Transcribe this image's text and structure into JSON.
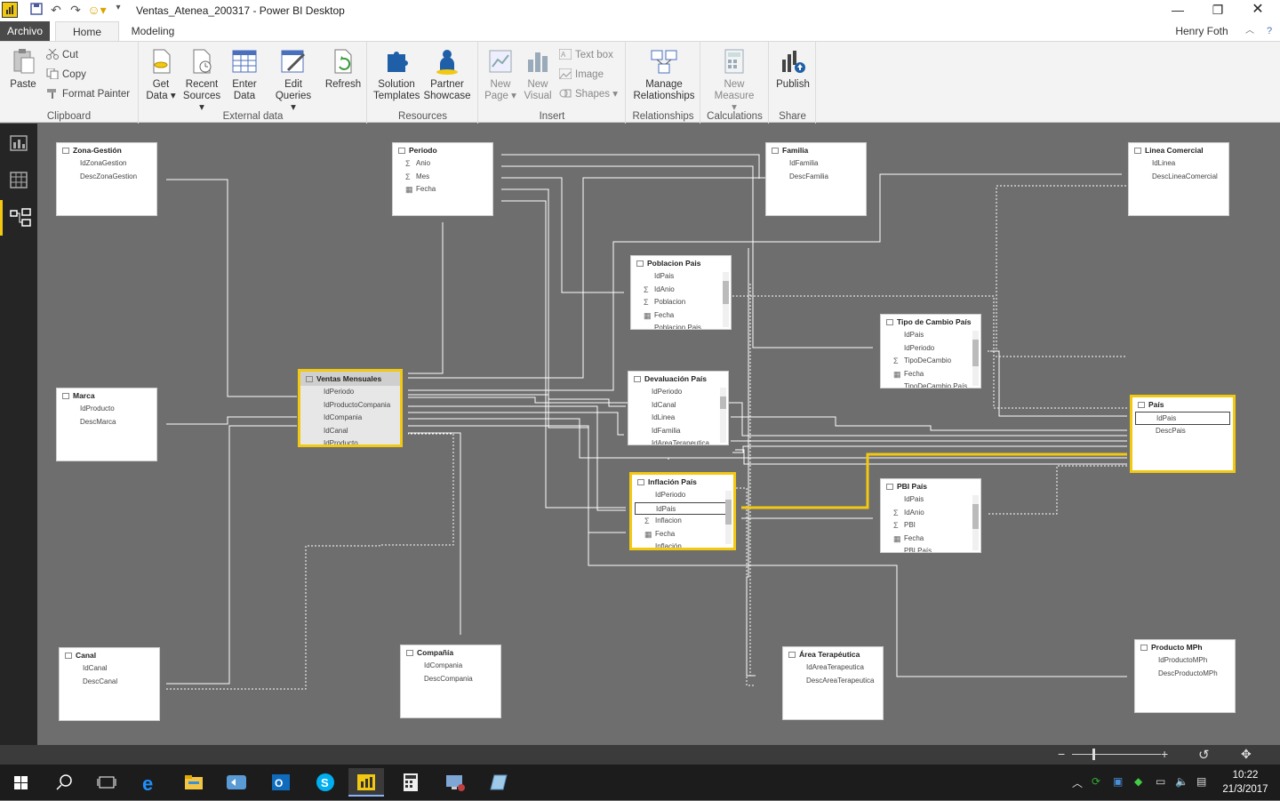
{
  "window": {
    "title": "Ventas_Atenea_200317 - Power BI Desktop",
    "user": "Henry Foth"
  },
  "tabs": [
    "Archivo",
    "Home",
    "Modeling"
  ],
  "ribbon": {
    "clipboard": {
      "label": "Clipboard",
      "paste": "Paste",
      "cut": "Cut",
      "copy": "Copy",
      "format_painter": "Format Painter"
    },
    "external": {
      "label": "External data",
      "get_data": "Get",
      "get_data2": "Data",
      "recent": "Recent",
      "recent2": "Sources",
      "enter": "Enter",
      "enter2": "Data",
      "edit": "Edit",
      "edit2": "Queries",
      "refresh": "Refresh"
    },
    "resources": {
      "label": "Resources",
      "solution": "Solution",
      "solution2": "Templates",
      "partner": "Partner",
      "partner2": "Showcase"
    },
    "insert": {
      "label": "Insert",
      "new_page": "New",
      "new_page2": "Page",
      "new_visual": "New",
      "new_visual2": "Visual",
      "text_box": "Text box",
      "image": "Image",
      "shapes": "Shapes"
    },
    "relationships": {
      "label": "Relationships",
      "manage": "Manage",
      "manage2": "Relationships"
    },
    "calculations": {
      "label": "Calculations",
      "new_measure": "New",
      "new_measure2": "Measure"
    },
    "share": {
      "label": "Share",
      "publish": "Publish"
    }
  },
  "tables": {
    "zona": {
      "name": "Zona-Gestión",
      "fields": [
        "IdZonaGestion",
        "DescZonaGestion"
      ]
    },
    "periodo": {
      "name": "Periodo",
      "fields": [
        "Anio",
        "Mes",
        "Fecha"
      ]
    },
    "familia": {
      "name": "Familia",
      "fields": [
        "IdFamilia",
        "DescFamilia"
      ]
    },
    "linea": {
      "name": "Linea Comercial",
      "fields": [
        "IdLinea",
        "DescLineaComercial"
      ]
    },
    "poblacion": {
      "name": "Poblacion Pais",
      "fields": [
        "IdPais",
        "IdAnio",
        "Poblacion",
        "Fecha",
        "Poblacion Pais"
      ]
    },
    "tipocambio": {
      "name": "Tipo de Cambio País",
      "fields": [
        "IdPais",
        "IdPeriodo",
        "TipoDeCambio",
        "Fecha",
        "TipoDeCambio País"
      ]
    },
    "marca": {
      "name": "Marca",
      "fields": [
        "IdProducto",
        "DescMarca"
      ]
    },
    "ventas": {
      "name": "Ventas Mensuales",
      "fields": [
        "IdPeriodo",
        "IdProductoCompania",
        "IdCompania",
        "IdCanal",
        "IdProducto"
      ]
    },
    "devaluacion": {
      "name": "Devaluación País",
      "fields": [
        "IdPeriodo",
        "IdCanal",
        "IdLinea",
        "IdFamilia",
        "IdAreaTerapeutica"
      ]
    },
    "pais": {
      "name": "País",
      "fields": [
        "IdPais",
        "DescPais"
      ]
    },
    "inflacion": {
      "name": "Inflación País",
      "fields": [
        "IdPeriodo",
        "IdPais",
        "Inflacion",
        "Fecha",
        "Inflación"
      ]
    },
    "pbi": {
      "name": "PBI País",
      "fields": [
        "IdPais",
        "IdAnio",
        "PBI",
        "Fecha",
        "PBI País"
      ]
    },
    "canal": {
      "name": "Canal",
      "fields": [
        "IdCanal",
        "DescCanal"
      ]
    },
    "compania": {
      "name": "Compañía",
      "fields": [
        "IdCompania",
        "DescCompania"
      ]
    },
    "area": {
      "name": "Área Terapéutica",
      "fields": [
        "IdAreaTerapeutica",
        "DescAreaTerapeutica"
      ]
    },
    "producto": {
      "name": "Producto MPh",
      "fields": [
        "IdProductoMPh",
        "DescProductoMPh"
      ]
    }
  },
  "taskbar": {
    "time": "10:22",
    "date": "21/3/2017"
  },
  "colors": {
    "accent": "#f2c811",
    "canvas": "#6e6e6e",
    "nav": "#252525"
  }
}
